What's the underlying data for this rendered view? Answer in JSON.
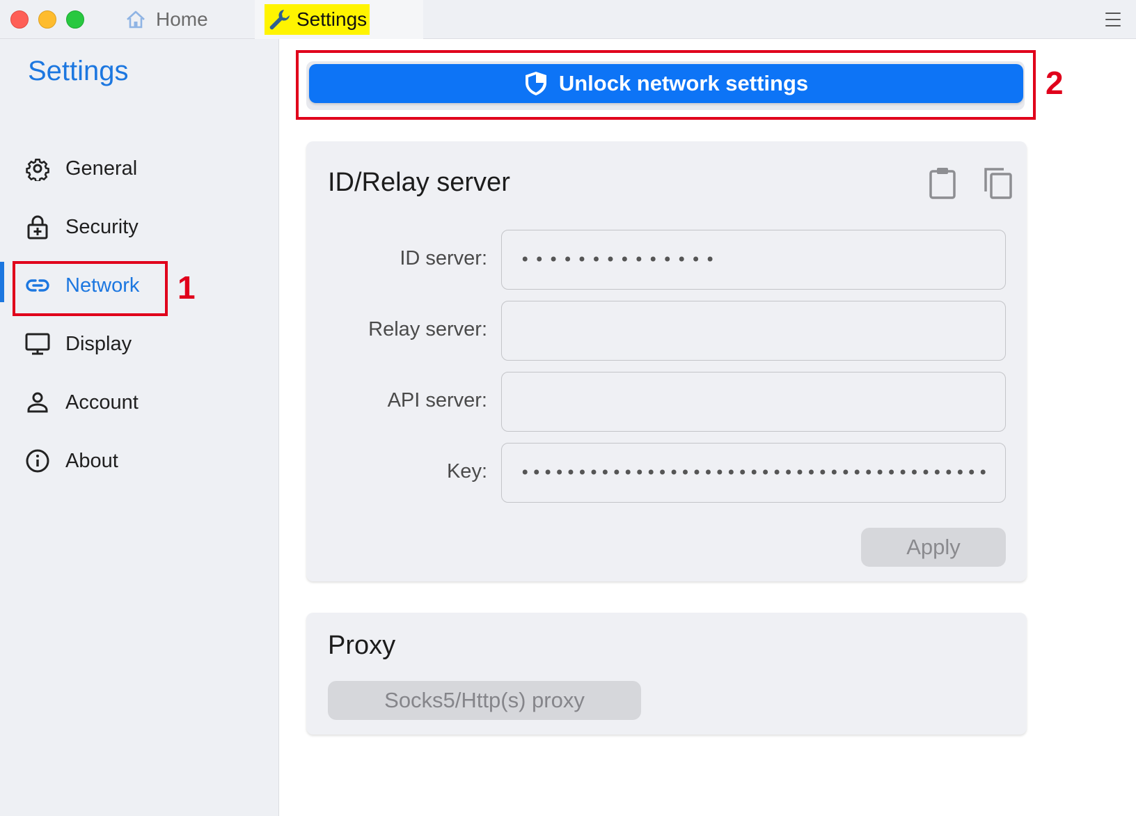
{
  "titlebar": {
    "tabs": [
      {
        "label": "Home",
        "icon": "home-icon"
      },
      {
        "label": "Settings",
        "icon": "wrench-icon"
      }
    ],
    "highlight_color": "#fff400"
  },
  "sidebar": {
    "title": "Settings",
    "items": [
      {
        "label": "General",
        "icon": "gear-icon"
      },
      {
        "label": "Security",
        "icon": "lock-icon"
      },
      {
        "label": "Network",
        "icon": "link-icon",
        "active": true
      },
      {
        "label": "Display",
        "icon": "monitor-icon"
      },
      {
        "label": "Account",
        "icon": "person-icon"
      },
      {
        "label": "About",
        "icon": "info-icon"
      }
    ]
  },
  "annotations": {
    "first": "1",
    "second": "2",
    "color": "#e0001b"
  },
  "main": {
    "unlock_label": "Unlock network settings",
    "accent_color": "#0d74f6",
    "relay_card": {
      "title": "ID/Relay server",
      "fields": [
        {
          "label": "ID server:",
          "value": "••••••••••••••"
        },
        {
          "label": "Relay server:",
          "value": ""
        },
        {
          "label": "API server:",
          "value": ""
        },
        {
          "label": "Key:",
          "value": "••••••••••••••••••••••••••••••••••••••••••••••••"
        }
      ],
      "apply_label": "Apply"
    },
    "proxy_card": {
      "title": "Proxy",
      "button_label": "Socks5/Http(s) proxy"
    }
  }
}
